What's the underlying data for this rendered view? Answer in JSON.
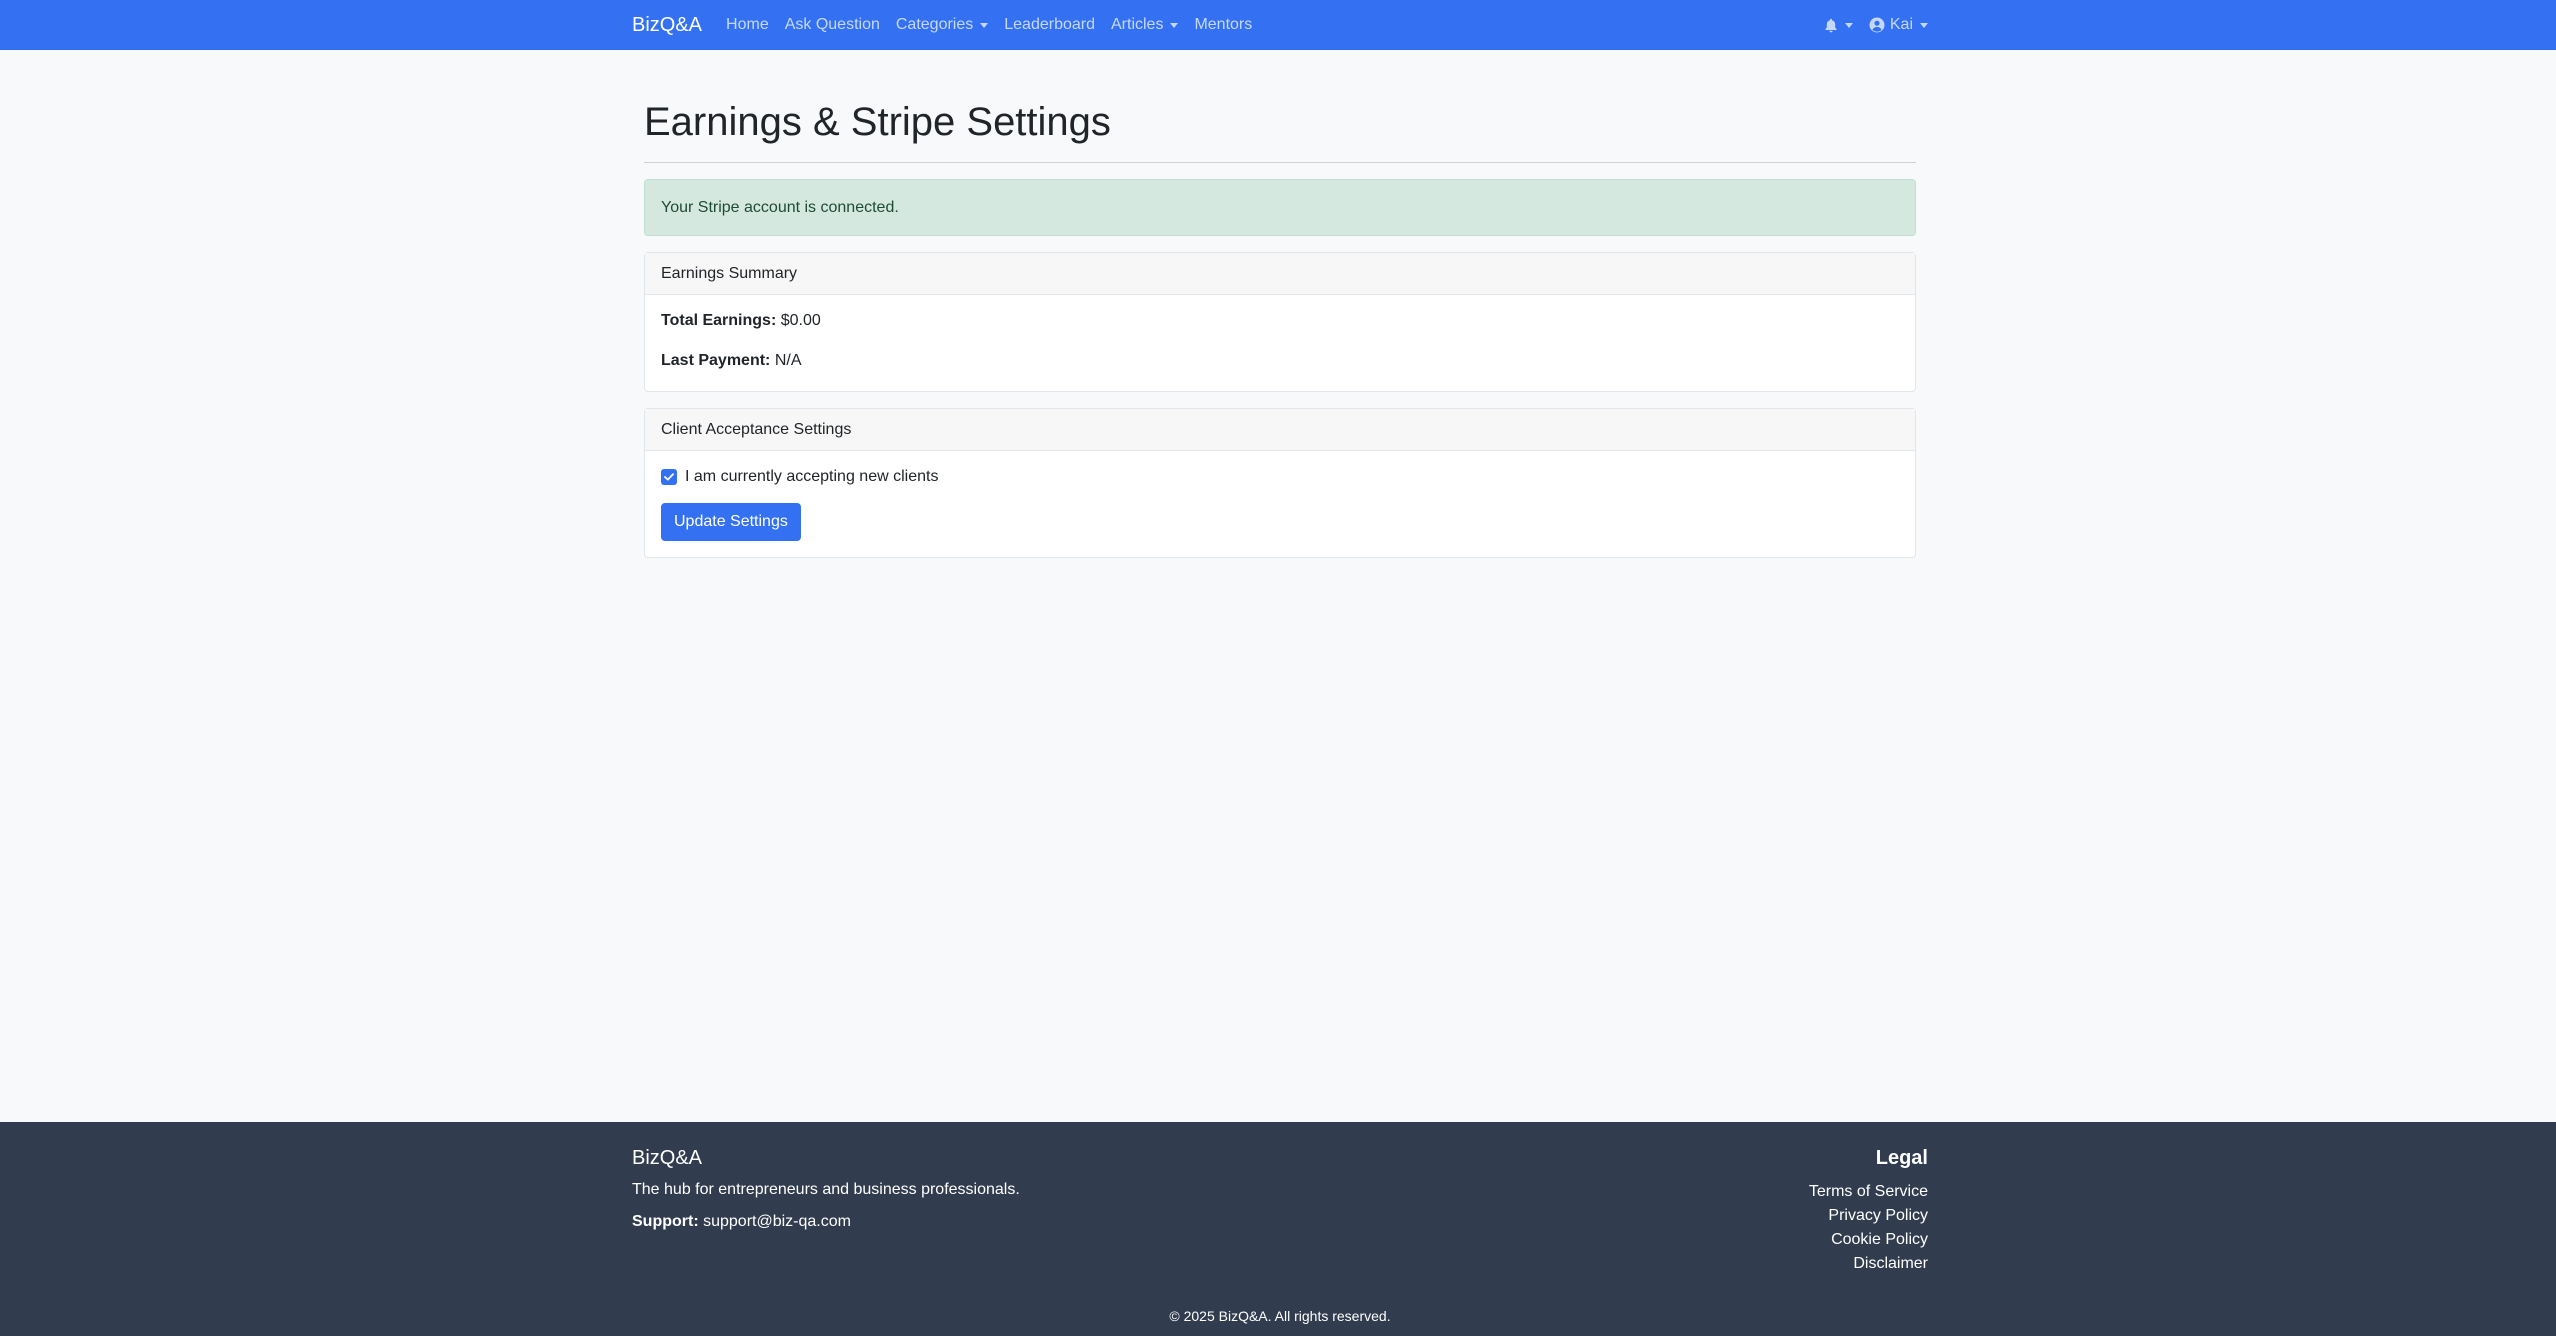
{
  "navbar": {
    "brand": "BizQ&A",
    "links": [
      {
        "label": "Home",
        "dropdown": false
      },
      {
        "label": "Ask Question",
        "dropdown": false
      },
      {
        "label": "Categories",
        "dropdown": true
      },
      {
        "label": "Leaderboard",
        "dropdown": false
      },
      {
        "label": "Articles",
        "dropdown": true
      },
      {
        "label": "Mentors",
        "dropdown": false
      }
    ],
    "notifications_icon": "bell-icon",
    "user_icon": "user-circle-icon",
    "user_name": "Kai"
  },
  "main": {
    "title": "Earnings & Stripe Settings",
    "alert": "Your Stripe account is connected.",
    "earnings_card": {
      "header": "Earnings Summary",
      "total_label": "Total Earnings:",
      "total_value": "$0.00",
      "last_payment_label": "Last Payment:",
      "last_payment_value": "N/A"
    },
    "client_card": {
      "header": "Client Acceptance Settings",
      "checkbox_label": "I am currently accepting new clients",
      "checkbox_checked": true,
      "button_label": "Update Settings"
    }
  },
  "footer": {
    "brand": "BizQ&A",
    "tagline": "The hub for entrepreneurs and business professionals.",
    "support_label": "Support:",
    "support_email": "support@biz-qa.com",
    "legal_heading": "Legal",
    "legal_links": [
      "Terms of Service",
      "Privacy Policy",
      "Cookie Policy",
      "Disclaimer"
    ],
    "copyright": "© 2025 BizQ&A. All rights reserved."
  },
  "colors": {
    "primary": "#3371f2",
    "page_background": "#f8f9fa",
    "alert_background": "#d5e8df",
    "footer_background": "#313c4f"
  }
}
